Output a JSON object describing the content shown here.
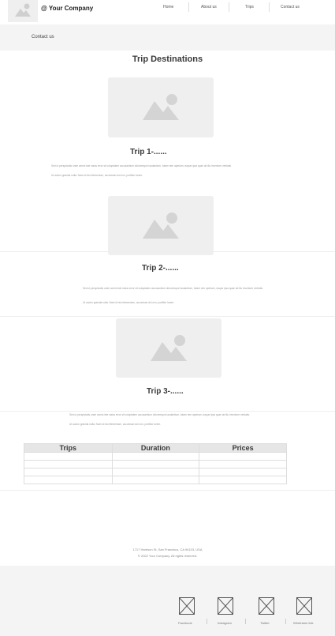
{
  "header": {
    "brand": "@  Your Company",
    "nav": [
      "Home",
      "About us",
      "Trips",
      "Contact us"
    ]
  },
  "band": {
    "label": "Contact us"
  },
  "page_title": "Trip Destinations",
  "trips": [
    {
      "title": "Trip 1-......",
      "text1": "Sed ut perspiciatis unde omnis iste natus error sit voluptatem accusantium doloremque laudantium, totam rem aperiam, eaque ipsa quae ab illo inventore veritatis",
      "text2": "Ut auctor gravida nulla. Nam id nisl elementum, accumsan dui non, porttitor lorem."
    },
    {
      "title": "Trip 2-......",
      "text1": "Sed ut perspiciatis unde omnis iste natus error sit voluptatem accusantium doloremque laudantium, totam rem aperiam, eaque ipsa quae ab illo inventore veritatis.",
      "text2": "Ut auctor gravida nulla. Nam id nisl elementum, accumsan dui non, porttitor lorem."
    },
    {
      "title": "Trip 3-......",
      "text1": "Sed ut perspiciatis unde omnis iste natus error sit voluptatem accusantium doloremque laudantium, totam rem aperiam, eaque ipsa quae ab illo inventore veritatis.",
      "text2": "Ut auctor gravida nulla. Nam id nisl elementum, accumsan dui non, porttitor lorem."
    }
  ],
  "table": {
    "headers": [
      "Trips",
      "Duration",
      "Prices"
    ],
    "rows": [
      [
        "",
        "",
        ""
      ],
      [
        "",
        "",
        ""
      ],
      [
        "",
        "",
        ""
      ],
      [
        "",
        "",
        ""
      ]
    ]
  },
  "footer": {
    "address": "1717 Harrison St, San Francisco, CA 94103, USA",
    "copyright": "© 2022 Your Company.  All rights reserved.",
    "social": [
      "Facebook",
      "Instagram",
      "Twitter",
      "Wireframe link"
    ]
  },
  "colors": {
    "placeholder": "#efefef",
    "band": "#f4f4f4",
    "icon": "#cfcfcf"
  }
}
